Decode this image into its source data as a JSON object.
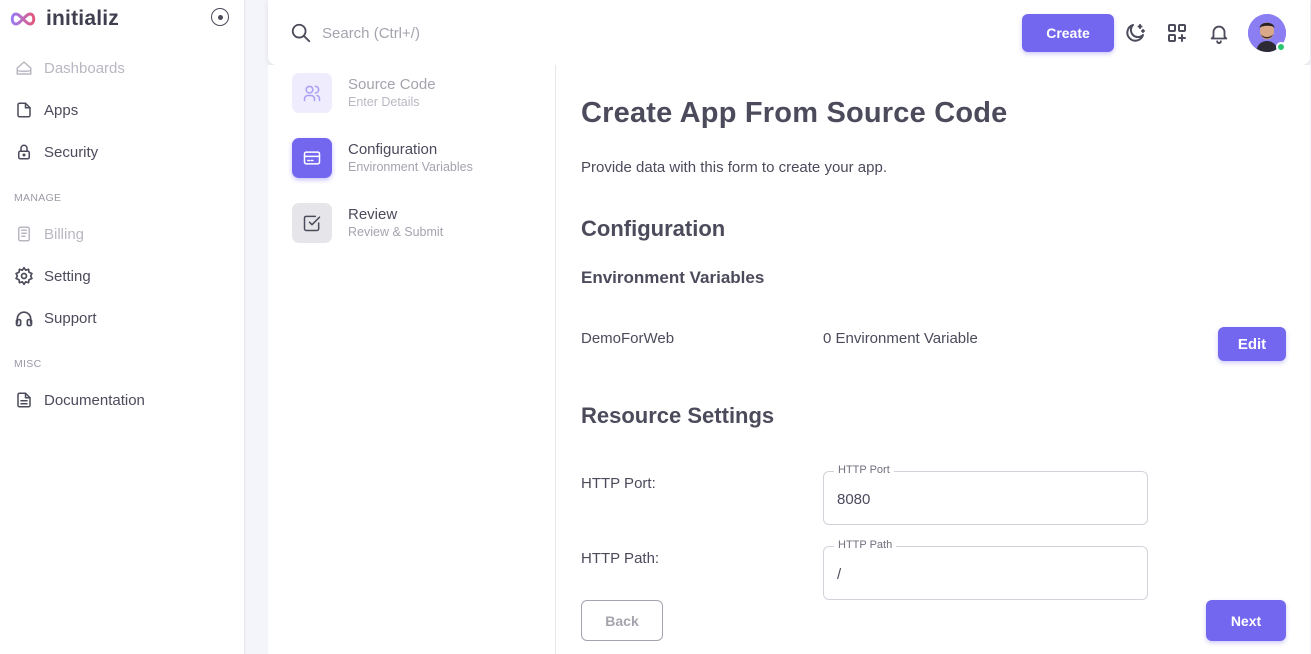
{
  "brand": {
    "name": "initializ",
    "accent": "#7367f0"
  },
  "sidebar": {
    "items": [
      {
        "label": "Dashboards",
        "icon": "home-icon",
        "disabled": true
      },
      {
        "label": "Apps",
        "icon": "file-icon"
      },
      {
        "label": "Security",
        "icon": "lock-icon"
      },
      {
        "label": "Billing",
        "icon": "receipt-icon",
        "disabled": true
      },
      {
        "label": "Setting",
        "icon": "gear-icon"
      },
      {
        "label": "Support",
        "icon": "headphones-icon"
      },
      {
        "label": "Documentation",
        "icon": "document-icon"
      }
    ],
    "sections": {
      "manage": "MANAGE",
      "misc": "MISC"
    }
  },
  "topbar": {
    "search_placeholder": "Search (Ctrl+/)",
    "create_label": "Create",
    "icons": [
      "moon-icon",
      "apps-add-icon",
      "bell-icon"
    ],
    "status_color": "#28c76f"
  },
  "steps": [
    {
      "title": "Source Code",
      "subtitle": "Enter Details",
      "icon": "users-icon",
      "state": "done"
    },
    {
      "title": "Configuration",
      "subtitle": "Environment Variables",
      "icon": "card-icon",
      "state": "active"
    },
    {
      "title": "Review",
      "subtitle": "Review & Submit",
      "icon": "checkbox-icon",
      "state": "pending"
    }
  ],
  "main": {
    "title": "Create App From Source Code",
    "description": "Provide data with this form to create your app.",
    "configuration_heading": "Configuration",
    "env_heading": "Environment Variables",
    "env_name": "DemoForWeb",
    "env_count": "0 Environment Variable",
    "edit_label": "Edit",
    "resource_heading": "Resource Settings",
    "http_port": {
      "label": "HTTP Port:",
      "legend": "HTTP Port",
      "value": "8080"
    },
    "http_path": {
      "label": "HTTP Path:",
      "legend": "HTTP Path",
      "value": "/"
    },
    "back_label": "Back",
    "next_label": "Next"
  }
}
